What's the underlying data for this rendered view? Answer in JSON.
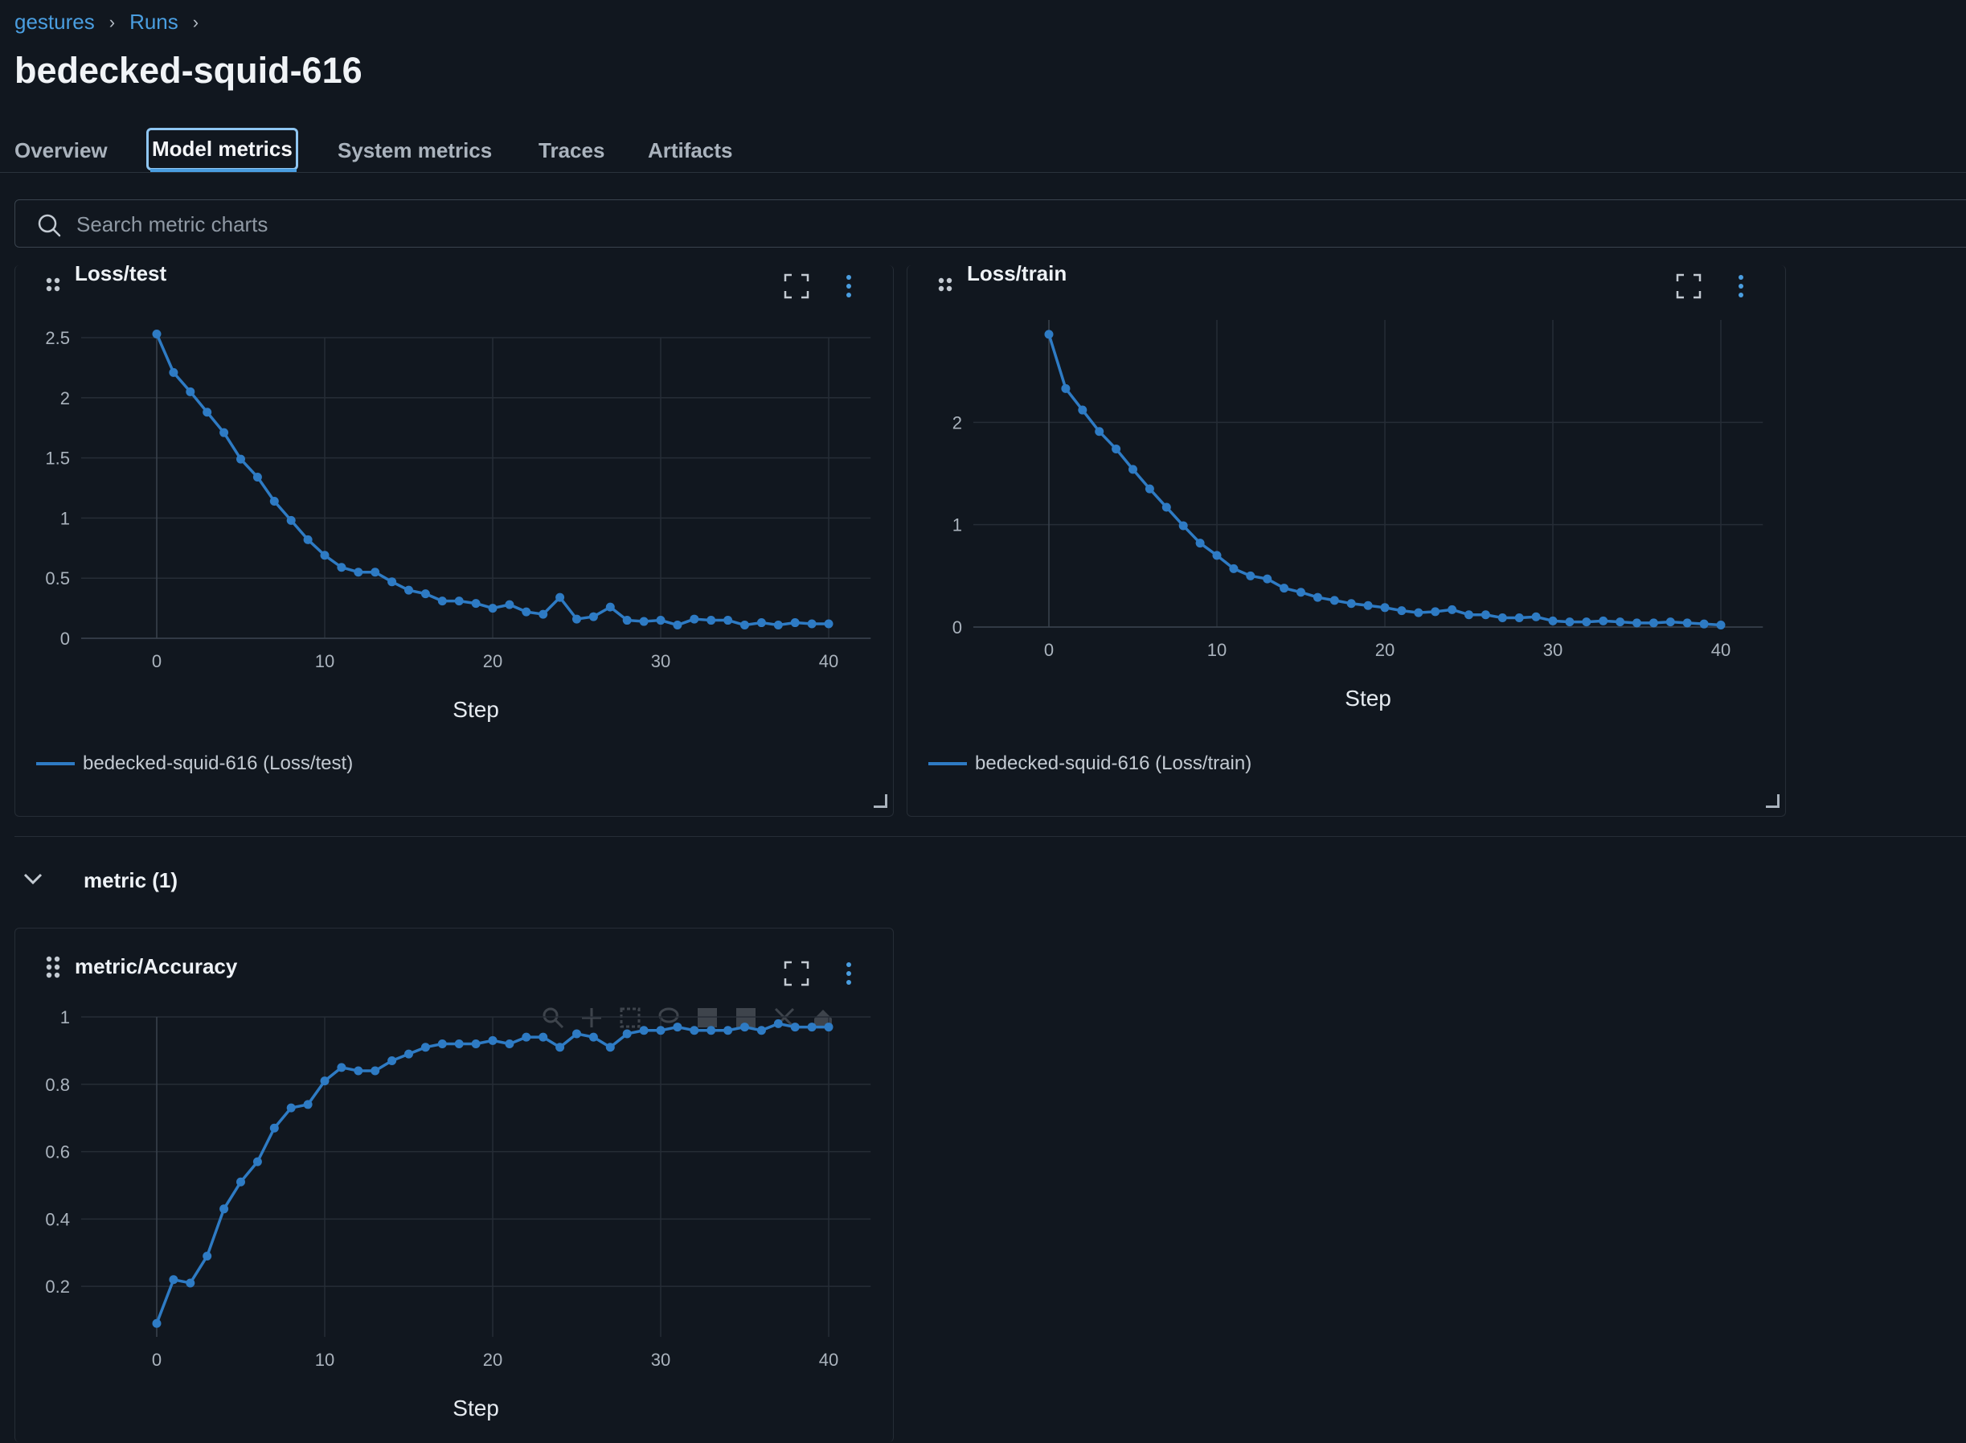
{
  "breadcrumb": {
    "items": [
      "gestures",
      "Runs"
    ],
    "separator": "›"
  },
  "run_title": "bedecked-squid-616",
  "tabs": [
    "Overview",
    "Model metrics",
    "System metrics",
    "Traces",
    "Artifacts"
  ],
  "active_tab": "Model metrics",
  "search": {
    "placeholder": "Search metric charts",
    "value": ""
  },
  "section": {
    "label": "metric (1)"
  },
  "colors": {
    "background": "#11171f",
    "accent": "#4a9ee0",
    "series": "#2e7bc4"
  },
  "chart_data": [
    {
      "type": "line",
      "title": "Loss/test",
      "xlabel": "Step",
      "ylabel": "",
      "xlim": [
        -4.5,
        42.5
      ],
      "ylim": [
        0,
        2.5
      ],
      "xticks": [
        0,
        10,
        20,
        30,
        40
      ],
      "yticks": [
        0,
        0.5,
        1,
        1.5,
        2,
        2.5
      ],
      "ytick_labels": [
        "0",
        "0.5",
        "1",
        "1.5",
        "2",
        "2.5"
      ],
      "legend": "bottom-left",
      "series": [
        {
          "name": "bedecked-squid-616 (Loss/test)",
          "x": [
            0,
            1,
            2,
            3,
            4,
            5,
            6,
            7,
            8,
            9,
            10,
            11,
            12,
            13,
            14,
            15,
            16,
            17,
            18,
            19,
            20,
            21,
            22,
            23,
            24,
            25,
            26,
            27,
            28,
            29,
            30,
            31,
            32,
            33,
            34,
            35,
            36,
            37,
            38,
            39,
            40
          ],
          "y": [
            2.53,
            2.21,
            2.05,
            1.88,
            1.71,
            1.49,
            1.34,
            1.14,
            0.98,
            0.82,
            0.69,
            0.59,
            0.55,
            0.55,
            0.47,
            0.4,
            0.37,
            0.31,
            0.31,
            0.29,
            0.25,
            0.28,
            0.22,
            0.2,
            0.34,
            0.16,
            0.18,
            0.26,
            0.15,
            0.14,
            0.15,
            0.11,
            0.16,
            0.15,
            0.15,
            0.11,
            0.13,
            0.11,
            0.13,
            0.12,
            0.12
          ]
        }
      ]
    },
    {
      "type": "line",
      "title": "Loss/train",
      "xlabel": "Step",
      "ylabel": "",
      "xlim": [
        -4.5,
        42.5
      ],
      "ylim": [
        0,
        3.0
      ],
      "xticks": [
        0,
        10,
        20,
        30,
        40
      ],
      "yticks": [
        0,
        1,
        2
      ],
      "ytick_labels": [
        "0",
        "1",
        "2"
      ],
      "legend": "bottom-left",
      "series": [
        {
          "name": "bedecked-squid-616 (Loss/train)",
          "x": [
            0,
            1,
            2,
            3,
            4,
            5,
            6,
            7,
            8,
            9,
            10,
            11,
            12,
            13,
            14,
            15,
            16,
            17,
            18,
            19,
            20,
            21,
            22,
            23,
            24,
            25,
            26,
            27,
            28,
            29,
            30,
            31,
            32,
            33,
            34,
            35,
            36,
            37,
            38,
            39,
            40
          ],
          "y": [
            2.86,
            2.33,
            2.12,
            1.91,
            1.74,
            1.54,
            1.35,
            1.17,
            0.99,
            0.82,
            0.7,
            0.57,
            0.5,
            0.47,
            0.38,
            0.34,
            0.29,
            0.26,
            0.23,
            0.21,
            0.19,
            0.16,
            0.14,
            0.15,
            0.17,
            0.12,
            0.12,
            0.09,
            0.09,
            0.1,
            0.06,
            0.05,
            0.05,
            0.06,
            0.05,
            0.04,
            0.04,
            0.05,
            0.04,
            0.03,
            0.02
          ]
        }
      ]
    },
    {
      "type": "line",
      "title": "metric/Accuracy",
      "xlabel": "Step",
      "ylabel": "",
      "xlim": [
        -4.5,
        42.5
      ],
      "ylim": [
        0.05,
        1.0
      ],
      "xticks": [
        0,
        10,
        20,
        30,
        40
      ],
      "yticks": [
        0.2,
        0.4,
        0.6,
        0.8,
        1
      ],
      "ytick_labels": [
        "0.2",
        "0.4",
        "0.6",
        "0.8",
        "1"
      ],
      "series": [
        {
          "name": "",
          "x": [
            0,
            1,
            2,
            3,
            4,
            5,
            6,
            7,
            8,
            9,
            10,
            11,
            12,
            13,
            14,
            15,
            16,
            17,
            18,
            19,
            20,
            21,
            22,
            23,
            24,
            25,
            26,
            27,
            28,
            29,
            30,
            31,
            32,
            33,
            34,
            35,
            36,
            37,
            38,
            39,
            40
          ],
          "y": [
            0.09,
            0.22,
            0.21,
            0.29,
            0.43,
            0.51,
            0.57,
            0.67,
            0.73,
            0.74,
            0.81,
            0.85,
            0.84,
            0.84,
            0.87,
            0.89,
            0.91,
            0.92,
            0.92,
            0.92,
            0.93,
            0.92,
            0.94,
            0.94,
            0.91,
            0.95,
            0.94,
            0.91,
            0.95,
            0.96,
            0.96,
            0.97,
            0.96,
            0.96,
            0.96,
            0.97,
            0.96,
            0.98,
            0.97,
            0.97,
            0.97
          ]
        }
      ]
    }
  ]
}
